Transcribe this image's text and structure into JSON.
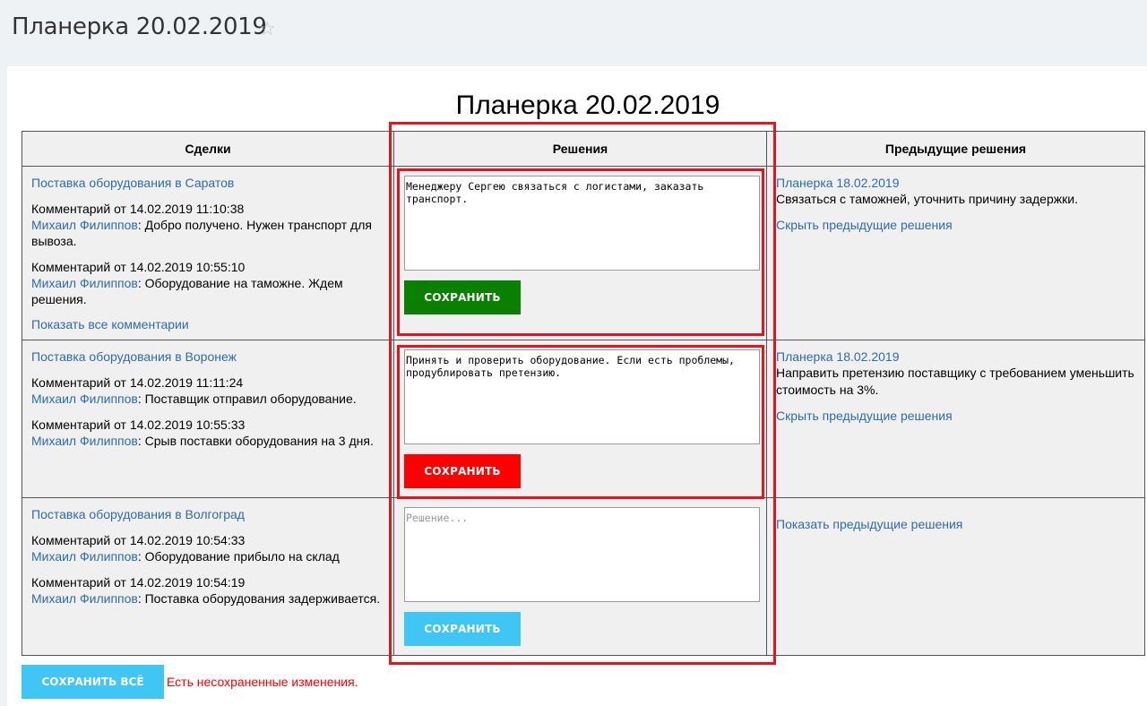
{
  "header": {
    "title": "Планерка 20.02.2019",
    "star_icon": "☆"
  },
  "doc_title": "Планерка 20.02.2019",
  "columns": [
    "Сделки",
    "Решения",
    "Предыдущие решения"
  ],
  "rows": [
    {
      "deal": "Поставка оборудования в Саратов",
      "comments": [
        {
          "meta": "Комментарий от 14.02.2019 11:10:38",
          "author": "Михаил Филиппов",
          "text": ": Добро получено. Нужен транспорт для вывоза."
        },
        {
          "meta": "Комментарий от 14.02.2019 10:55:10",
          "author": "Михаил Филиппов",
          "text": ": Оборудование на таможне. Ждем решения."
        }
      ],
      "show_all": "Показать все комментарии",
      "decision": "Менеджеру Сергею связаться с логистами, заказать транспорт.",
      "placeholder": "Решение...",
      "save_label": "СОХРАНИТЬ",
      "save_color": "#0a8000",
      "prev_title": "Планерка 18.02.2019",
      "prev_text": "Связаться с таможней, уточнить причину задержки.",
      "prev_toggle": "Скрыть предыдущие решения"
    },
    {
      "deal": "Поставка оборудования в Воронеж",
      "comments": [
        {
          "meta": "Комментарий от 14.02.2019 11:11:24",
          "author": "Михаил Филиппов",
          "text": ": Поставщик отправил оборудование."
        },
        {
          "meta": "Комментарий от 14.02.2019 10:55:33",
          "author": "Михаил Филиппов",
          "text": ": Срыв поставки оборудования на 3 дня."
        }
      ],
      "decision": "Принять и проверить оборудование. Если есть проблемы, продублировать претензию.",
      "placeholder": "Решение...",
      "save_label": "СОХРАНИТЬ",
      "save_color": "#ff0000",
      "prev_title": "Планерка 18.02.2019",
      "prev_text": "Направить претензию поставщику с требованием уменьшить стоимость на 3%.",
      "prev_toggle": "Скрыть предыдущие решения"
    },
    {
      "deal": "Поставка оборудования в Волгоград",
      "comments": [
        {
          "meta": "Комментарий от 14.02.2019 10:54:33",
          "author": "Михаил Филиппов",
          "text": ": Оборудование прибыло на склад"
        },
        {
          "meta": "Комментарий от 14.02.2019 10:54:19",
          "author": "Михаил Филиппов",
          "text": ": Поставка оборудования задерживается."
        }
      ],
      "decision": "",
      "placeholder": "Решение...",
      "save_label": "СОХРАНИТЬ",
      "save_color": "#3fc6f5",
      "prev_toggle": "Показать предыдущие решения"
    }
  ],
  "footer": {
    "save_all_label": "СОХРАНИТЬ ВСЁ",
    "save_all_color": "#3fc6f5",
    "unsaved_text": "Есть несохраненные изменения."
  },
  "colors": {
    "link": "#2e6ab1",
    "highlight": "#e3151d",
    "warning": "#ff0000"
  }
}
